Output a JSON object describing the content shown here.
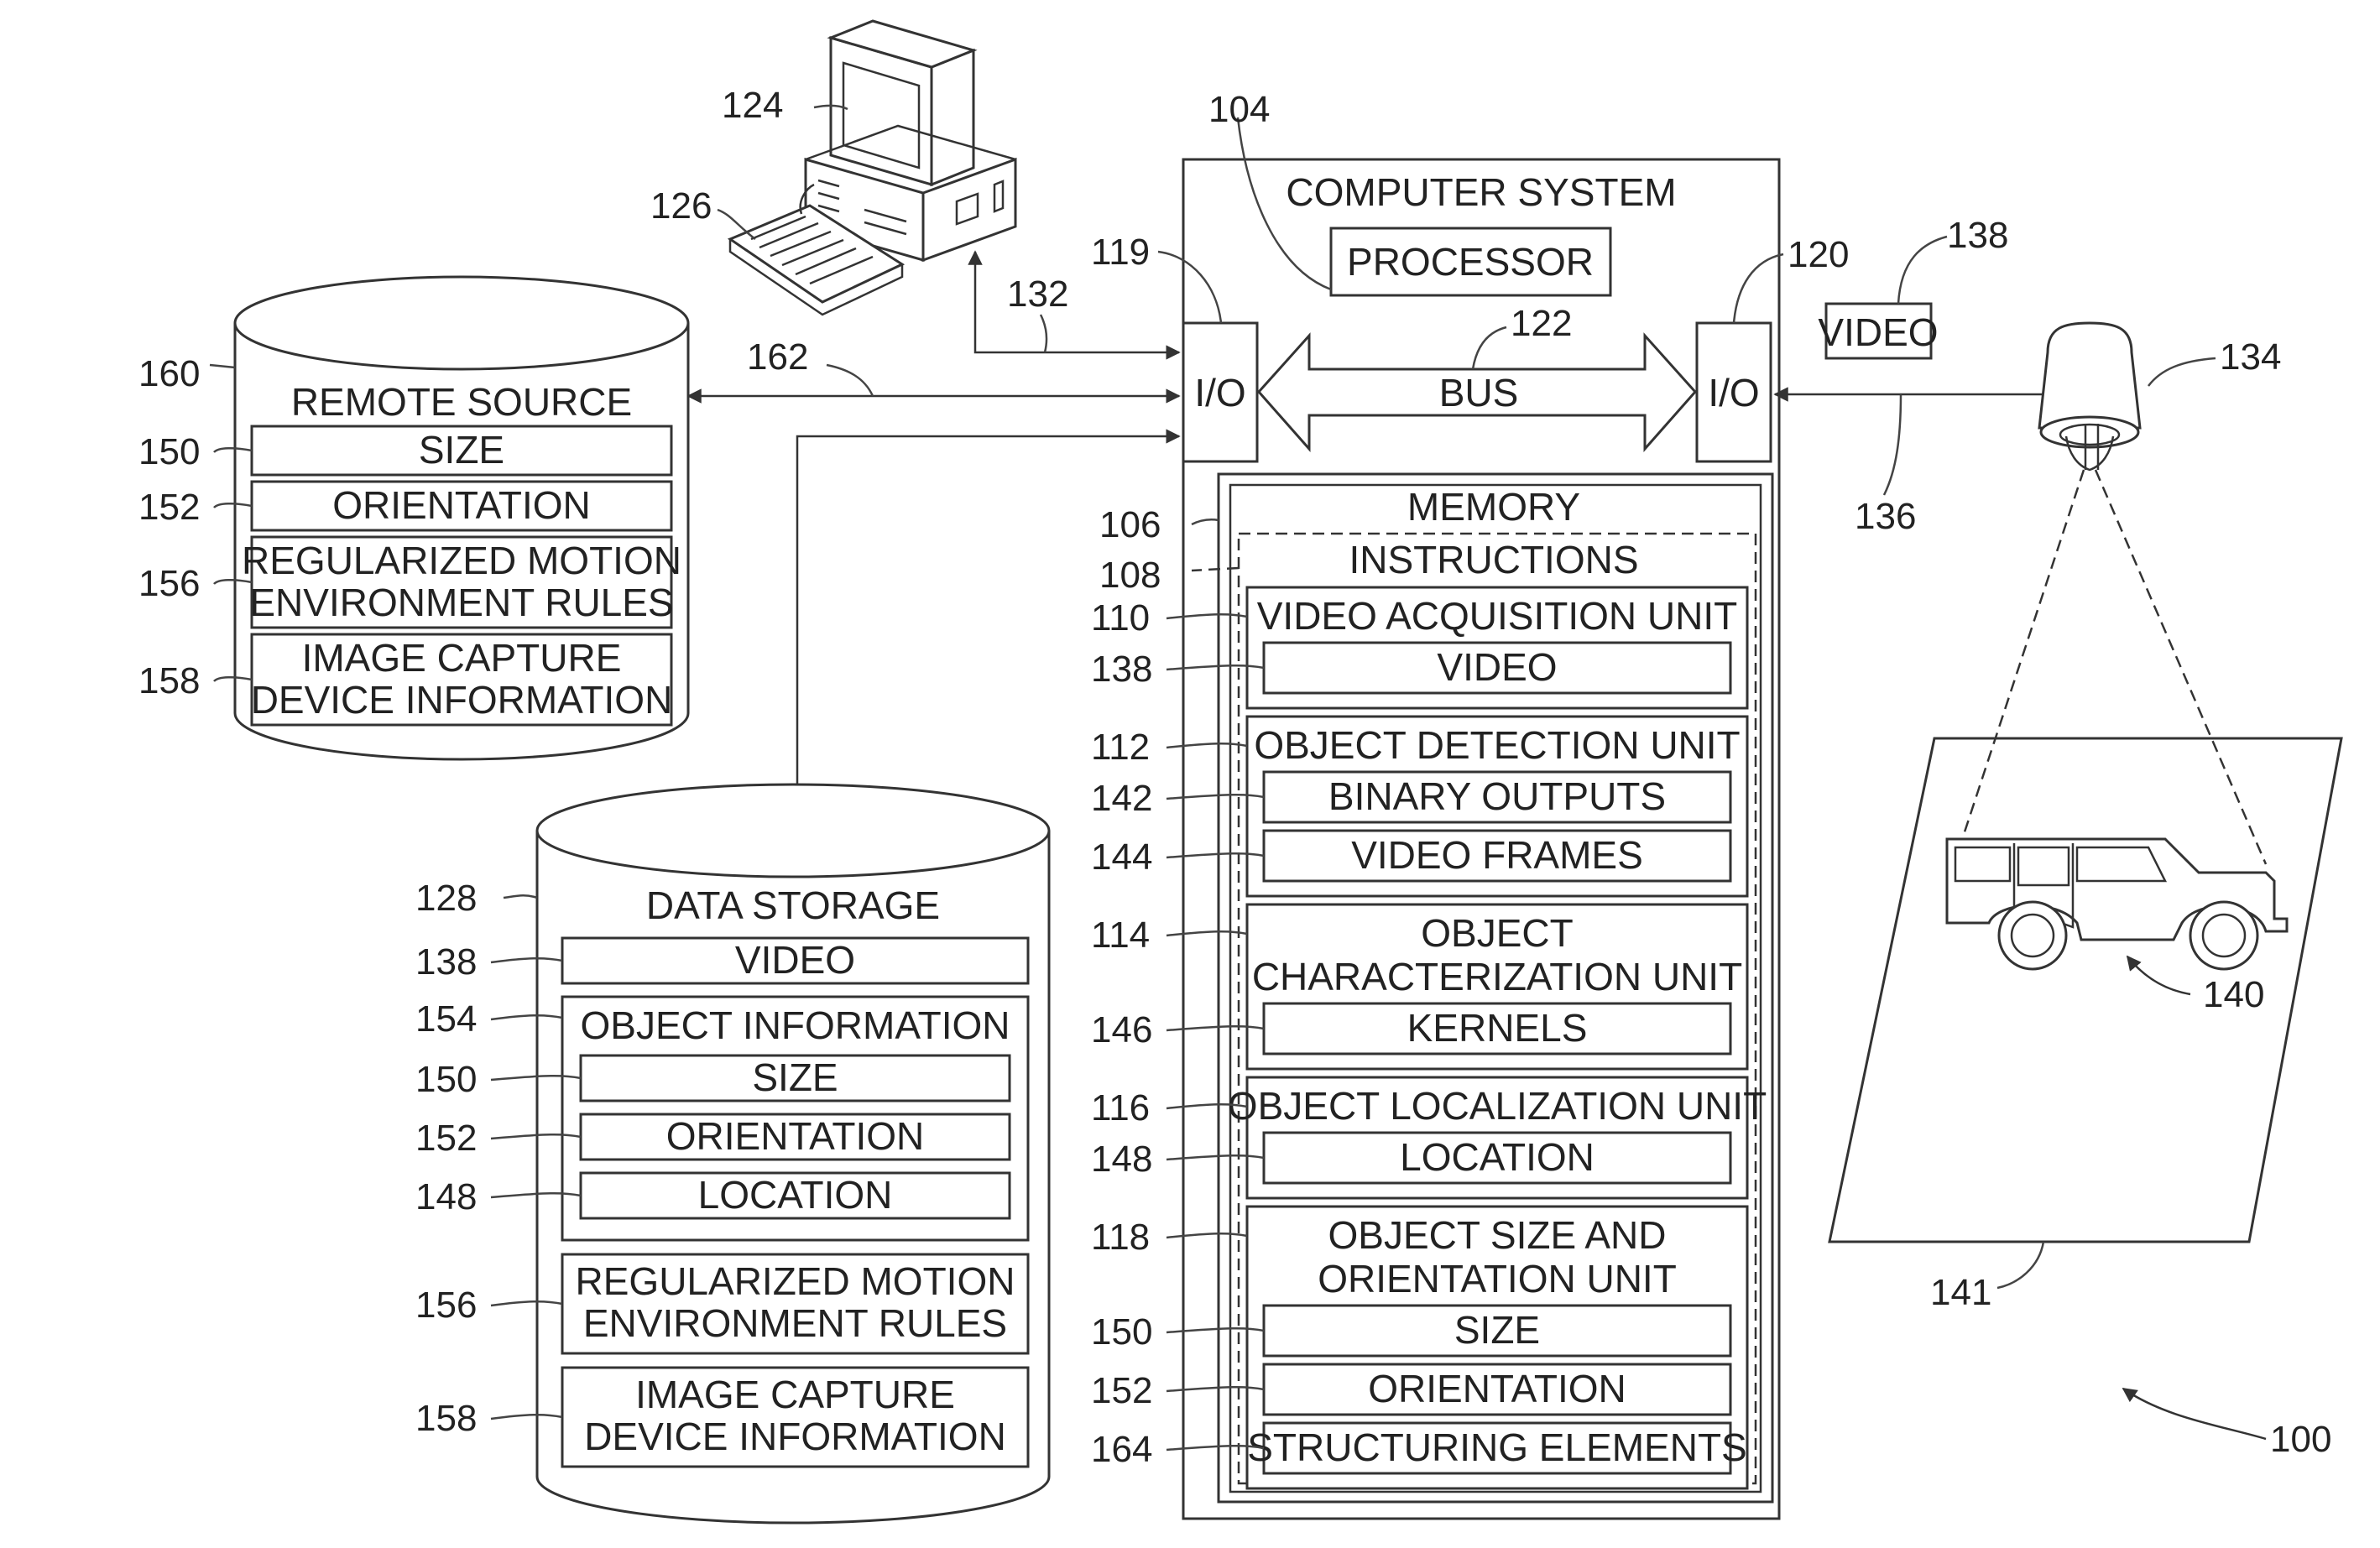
{
  "figure_number": "100",
  "computer_system": {
    "title": "COMPUTER SYSTEM",
    "processor": {
      "label": "PROCESSOR",
      "ref": "104"
    },
    "io_left": {
      "label": "I/O",
      "ref": "119"
    },
    "io_right": {
      "label": "I/O",
      "ref": "120"
    },
    "bus": {
      "label": "BUS",
      "ref": "122"
    },
    "memory": {
      "label": "MEMORY",
      "ref": "106",
      "instructions": {
        "label": "INSTRUCTIONS",
        "ref": "108"
      },
      "units": [
        {
          "ref": "110",
          "title_lines": [
            "VIDEO ACQUISITION UNIT"
          ],
          "items": [
            {
              "ref": "138",
              "label": "VIDEO"
            }
          ]
        },
        {
          "ref": "112",
          "title_lines": [
            "OBJECT DETECTION UNIT"
          ],
          "items": [
            {
              "ref": "142",
              "label": "BINARY OUTPUTS"
            },
            {
              "ref": "144",
              "label": "VIDEO FRAMES"
            }
          ]
        },
        {
          "ref": "114",
          "title_lines": [
            "OBJECT",
            "CHARACTERIZATION UNIT"
          ],
          "items": [
            {
              "ref": "146",
              "label": "KERNELS"
            }
          ]
        },
        {
          "ref": "116",
          "title_lines": [
            "OBJECT LOCALIZATION UNIT"
          ],
          "items": [
            {
              "ref": "148",
              "label": "LOCATION"
            }
          ]
        },
        {
          "ref": "118",
          "title_lines": [
            "OBJECT SIZE AND",
            "ORIENTATION UNIT"
          ],
          "items": [
            {
              "ref": "150",
              "label": "SIZE"
            },
            {
              "ref": "152",
              "label": "ORIENTATION"
            },
            {
              "ref": "164",
              "label": "STRUCTURING ELEMENTS"
            }
          ]
        }
      ]
    }
  },
  "workstation": {
    "display_ref": "124",
    "keyboard_ref": "126",
    "link_ref": "132"
  },
  "remote_source": {
    "title": "REMOTE SOURCE",
    "ref": "160",
    "link_ref": "162",
    "items": [
      {
        "ref": "150",
        "lines": [
          "SIZE"
        ]
      },
      {
        "ref": "152",
        "lines": [
          "ORIENTATION"
        ]
      },
      {
        "ref": "156",
        "lines": [
          "REGULARIZED MOTION",
          "ENVIRONMENT RULES"
        ]
      },
      {
        "ref": "158",
        "lines": [
          "IMAGE CAPTURE",
          "DEVICE INFORMATION"
        ]
      }
    ]
  },
  "data_storage": {
    "title": "DATA STORAGE",
    "ref": "128",
    "video": {
      "ref": "138",
      "label": "VIDEO"
    },
    "object_information": {
      "ref": "154",
      "label": "OBJECT INFORMATION",
      "items": [
        {
          "ref": "150",
          "label": "SIZE"
        },
        {
          "ref": "152",
          "label": "ORIENTATION"
        },
        {
          "ref": "148",
          "label": "LOCATION"
        }
      ]
    },
    "rules": {
      "ref": "156",
      "lines": [
        "REGULARIZED MOTION",
        "ENVIRONMENT RULES"
      ]
    },
    "device_info": {
      "ref": "158",
      "lines": [
        "IMAGE CAPTURE",
        "DEVICE INFORMATION"
      ]
    }
  },
  "camera": {
    "ref": "134",
    "link_ref": "136",
    "video": {
      "label": "VIDEO",
      "ref": "138"
    }
  },
  "scene": {
    "ref": "141",
    "vehicle_ref": "140"
  }
}
